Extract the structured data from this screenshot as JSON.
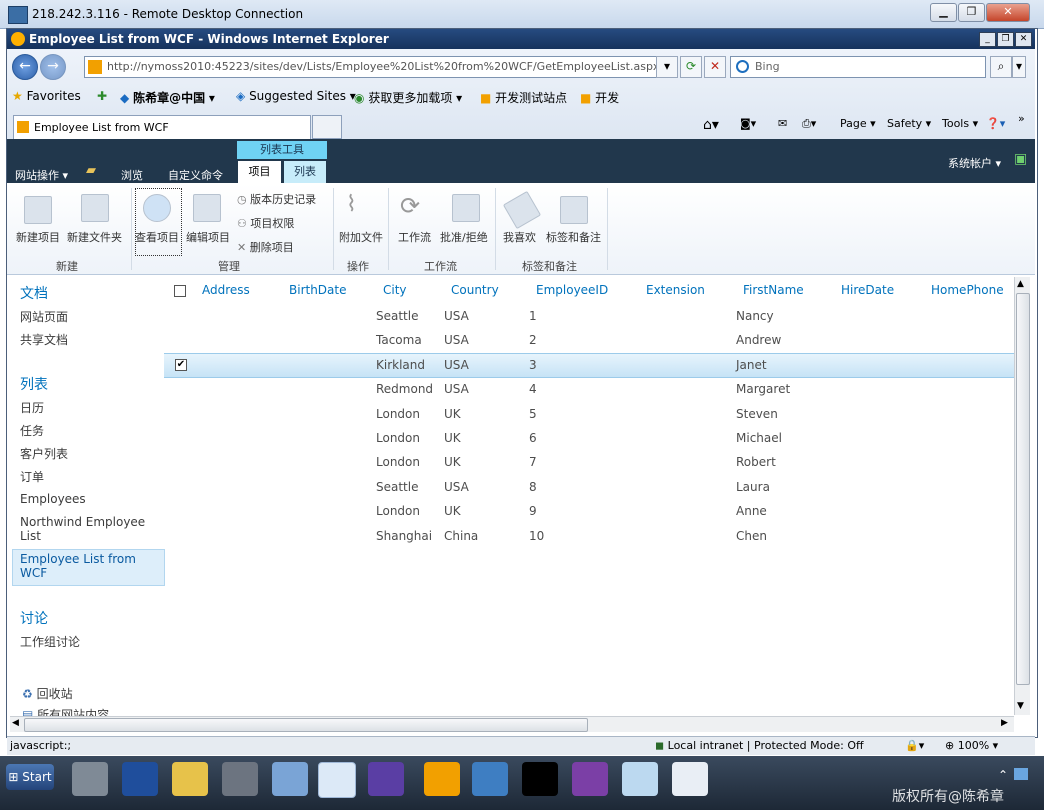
{
  "rdp": {
    "title": "218.242.3.116 - Remote Desktop Connection",
    "btn_min": "▁",
    "btn_max": "❐",
    "btn_close": "✕"
  },
  "ie": {
    "title": "Employee List from WCF - Windows Internet Explorer",
    "url": "http://nymoss2010:45223/sites/dev/Lists/Employee%20List%20from%20WCF/GetEmployeeList.aspx",
    "search_placeholder": "Bing",
    "favorites": "Favorites",
    "fav_links": [
      "陈希章@中国",
      "Suggested Sites",
      "获取更多加载项",
      "开发测试站点",
      "开发"
    ],
    "tab_title": "Employee List from WCF",
    "cmd": {
      "page": "Page",
      "safety": "Safety",
      "tools": "Tools"
    },
    "status_left": "javascript:;",
    "status_zone": "Local intranet | Protected Mode: Off",
    "zoom": "100%"
  },
  "sp": {
    "site_actions": "网站操作",
    "browse": "浏览",
    "custom_commands": "自定义命令",
    "context_group": "列表工具",
    "tab_items": "项目",
    "tab_list": "列表",
    "user": "系统帐户",
    "ribbon": {
      "new_item": "新建项目",
      "new_folder": "新建文件夹",
      "group_new": "新建",
      "view_item": "查看项目",
      "edit_item": "编辑项目",
      "version_history": "版本历史记录",
      "item_permissions": "项目权限",
      "delete_item": "删除项目",
      "group_manage": "管理",
      "attach_file": "附加文件",
      "group_actions": "操作",
      "workflow": "工作流",
      "approve_reject": "批准/拒绝",
      "group_workflow": "工作流",
      "i_like_it": "我喜欢",
      "tags_notes": "标签和备注",
      "group_tags": "标签和备注"
    },
    "quicknav": {
      "docs_head": "文档",
      "docs": [
        "网站页面",
        "共享文档"
      ],
      "lists_head": "列表",
      "lists": [
        "日历",
        "任务",
        "客户列表",
        "订单",
        "Employees",
        "Northwind Employee List",
        "Employee List from WCF"
      ],
      "disc_head": "讨论",
      "disc": [
        "工作组讨论"
      ],
      "recycle": "回收站",
      "all_content": "所有网站内容"
    },
    "columns": [
      "Address",
      "BirthDate",
      "City",
      "Country",
      "EmployeeID",
      "Extension",
      "FirstName",
      "HireDate",
      "HomePhone"
    ],
    "rows": [
      {
        "city": "Seattle",
        "country": "USA",
        "id": "1",
        "first": "Nancy"
      },
      {
        "city": "Tacoma",
        "country": "USA",
        "id": "2",
        "first": "Andrew"
      },
      {
        "city": "Kirkland",
        "country": "USA",
        "id": "3",
        "first": "Janet"
      },
      {
        "city": "Redmond",
        "country": "USA",
        "id": "4",
        "first": "Margaret"
      },
      {
        "city": "London",
        "country": "UK",
        "id": "5",
        "first": "Steven"
      },
      {
        "city": "London",
        "country": "UK",
        "id": "6",
        "first": "Michael"
      },
      {
        "city": "London",
        "country": "UK",
        "id": "7",
        "first": "Robert"
      },
      {
        "city": "Seattle",
        "country": "USA",
        "id": "8",
        "first": "Laura"
      },
      {
        "city": "London",
        "country": "UK",
        "id": "9",
        "first": "Anne"
      },
      {
        "city": "Shanghai",
        "country": "China",
        "id": "10",
        "first": "Chen"
      }
    ]
  },
  "taskbar": {
    "start": "Start",
    "watermark": "版权所有@陈希章"
  }
}
